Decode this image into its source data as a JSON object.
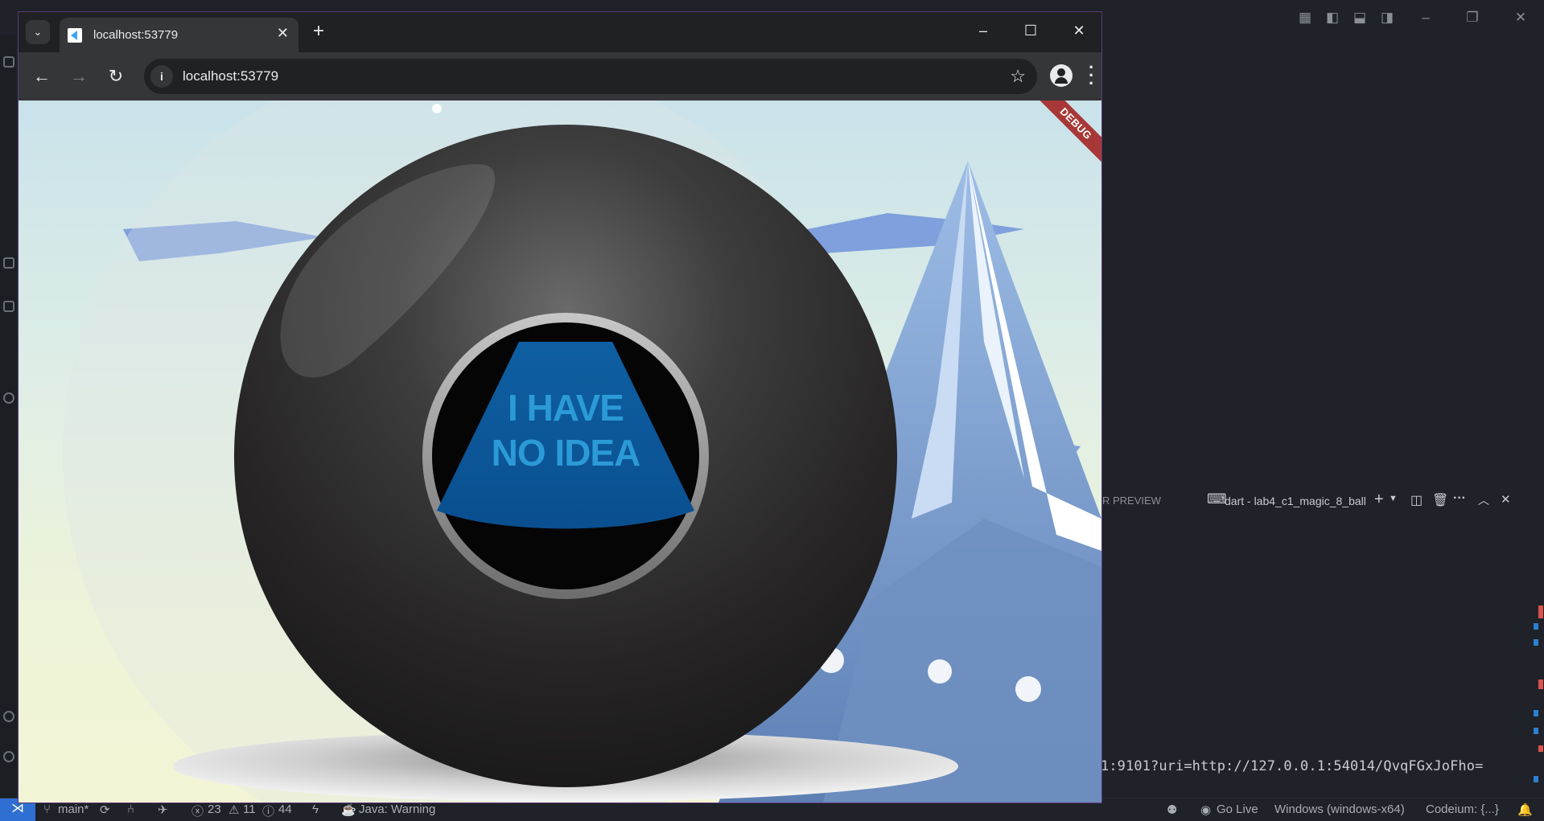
{
  "browser": {
    "tab_title": "localhost:53779",
    "url": "localhost:53779",
    "controls": {
      "minimize_icon": "minimize-icon",
      "maximize_icon": "maximize-icon",
      "close_icon": "close-icon"
    }
  },
  "app": {
    "debug_banner": "DEBUG",
    "answer_line1": "I HAVE",
    "answer_line2": "NO IDEA"
  },
  "vscode": {
    "panel_tab_partial": "R PREVIEW",
    "terminal_name": "dart - lab4_c1_magic_8_ball",
    "terminal_output": "1:9101?uri=http://127.0.0.1:54014/QvqFGxJoFho=",
    "status": {
      "branch": "main*",
      "errors": "23",
      "warnings": "11",
      "infos": "44",
      "java": "Java: Warning",
      "go_live": "Go Live",
      "platform": "Windows (windows-x64)",
      "codeium": "Codeium: {...}"
    }
  },
  "colors": {
    "chrome_dark": "#202124",
    "chrome_toolbar": "#35363a",
    "answer_blue": "#0a5fa8",
    "answer_text": "#2b9ad6",
    "debug_red": "#a83838",
    "statusbar_accent": "#2f6fd1"
  }
}
